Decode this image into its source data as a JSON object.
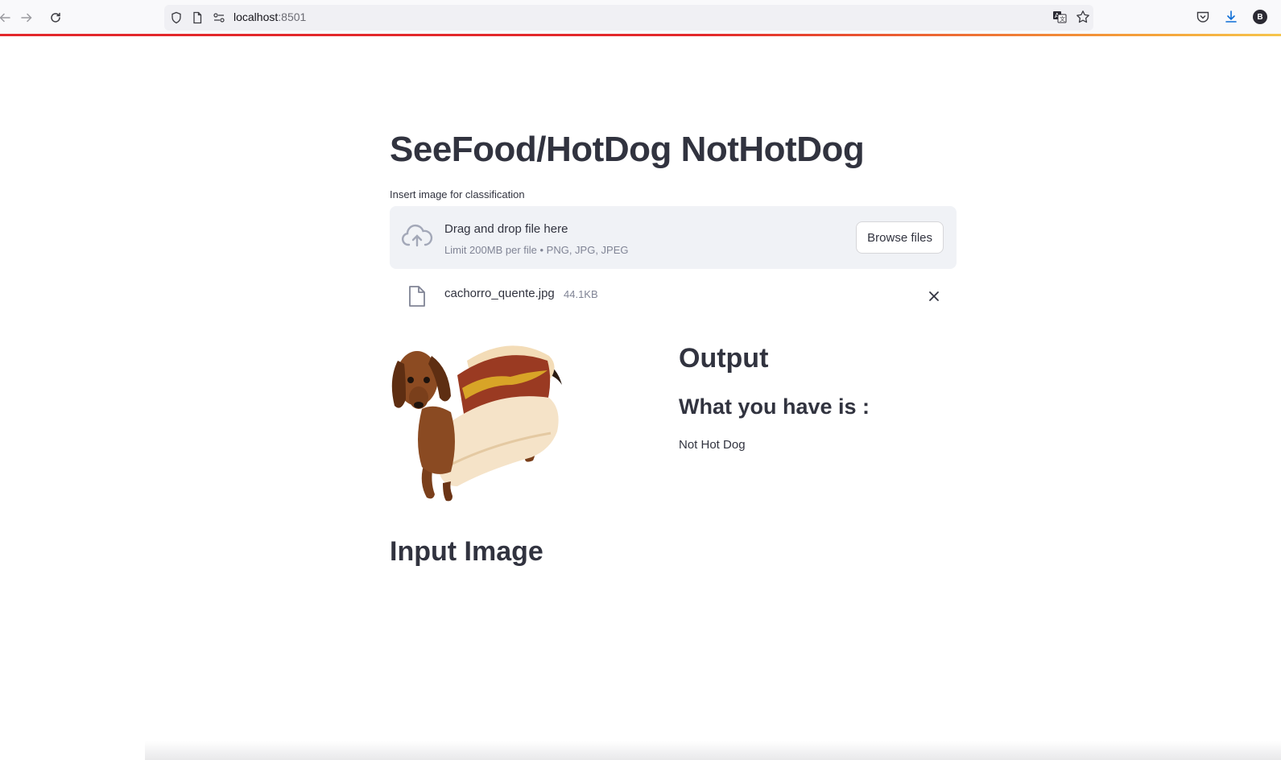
{
  "browser": {
    "url_host": "localhost",
    "url_port": ":8501",
    "profile_initial": "B"
  },
  "app": {
    "title": "SeeFood/HotDog NotHotDog",
    "uploader": {
      "label": "Insert image for classification",
      "drop_title": "Drag and drop file here",
      "drop_limit": "Limit 200MB per file • PNG, JPG, JPEG",
      "browse_label": "Browse files"
    },
    "uploaded_file": {
      "name": "cachorro_quente.jpg",
      "size": "44.1KB"
    },
    "output": {
      "heading": "Output",
      "result_heading": "What you have is :",
      "result_value": "Not Hot Dog"
    },
    "input_image_heading": "Input Image"
  },
  "colors": {
    "text": "#31333f",
    "muted": "#808495",
    "dropzone_bg": "#f0f2f6",
    "accent_bar": "#e3282b"
  }
}
